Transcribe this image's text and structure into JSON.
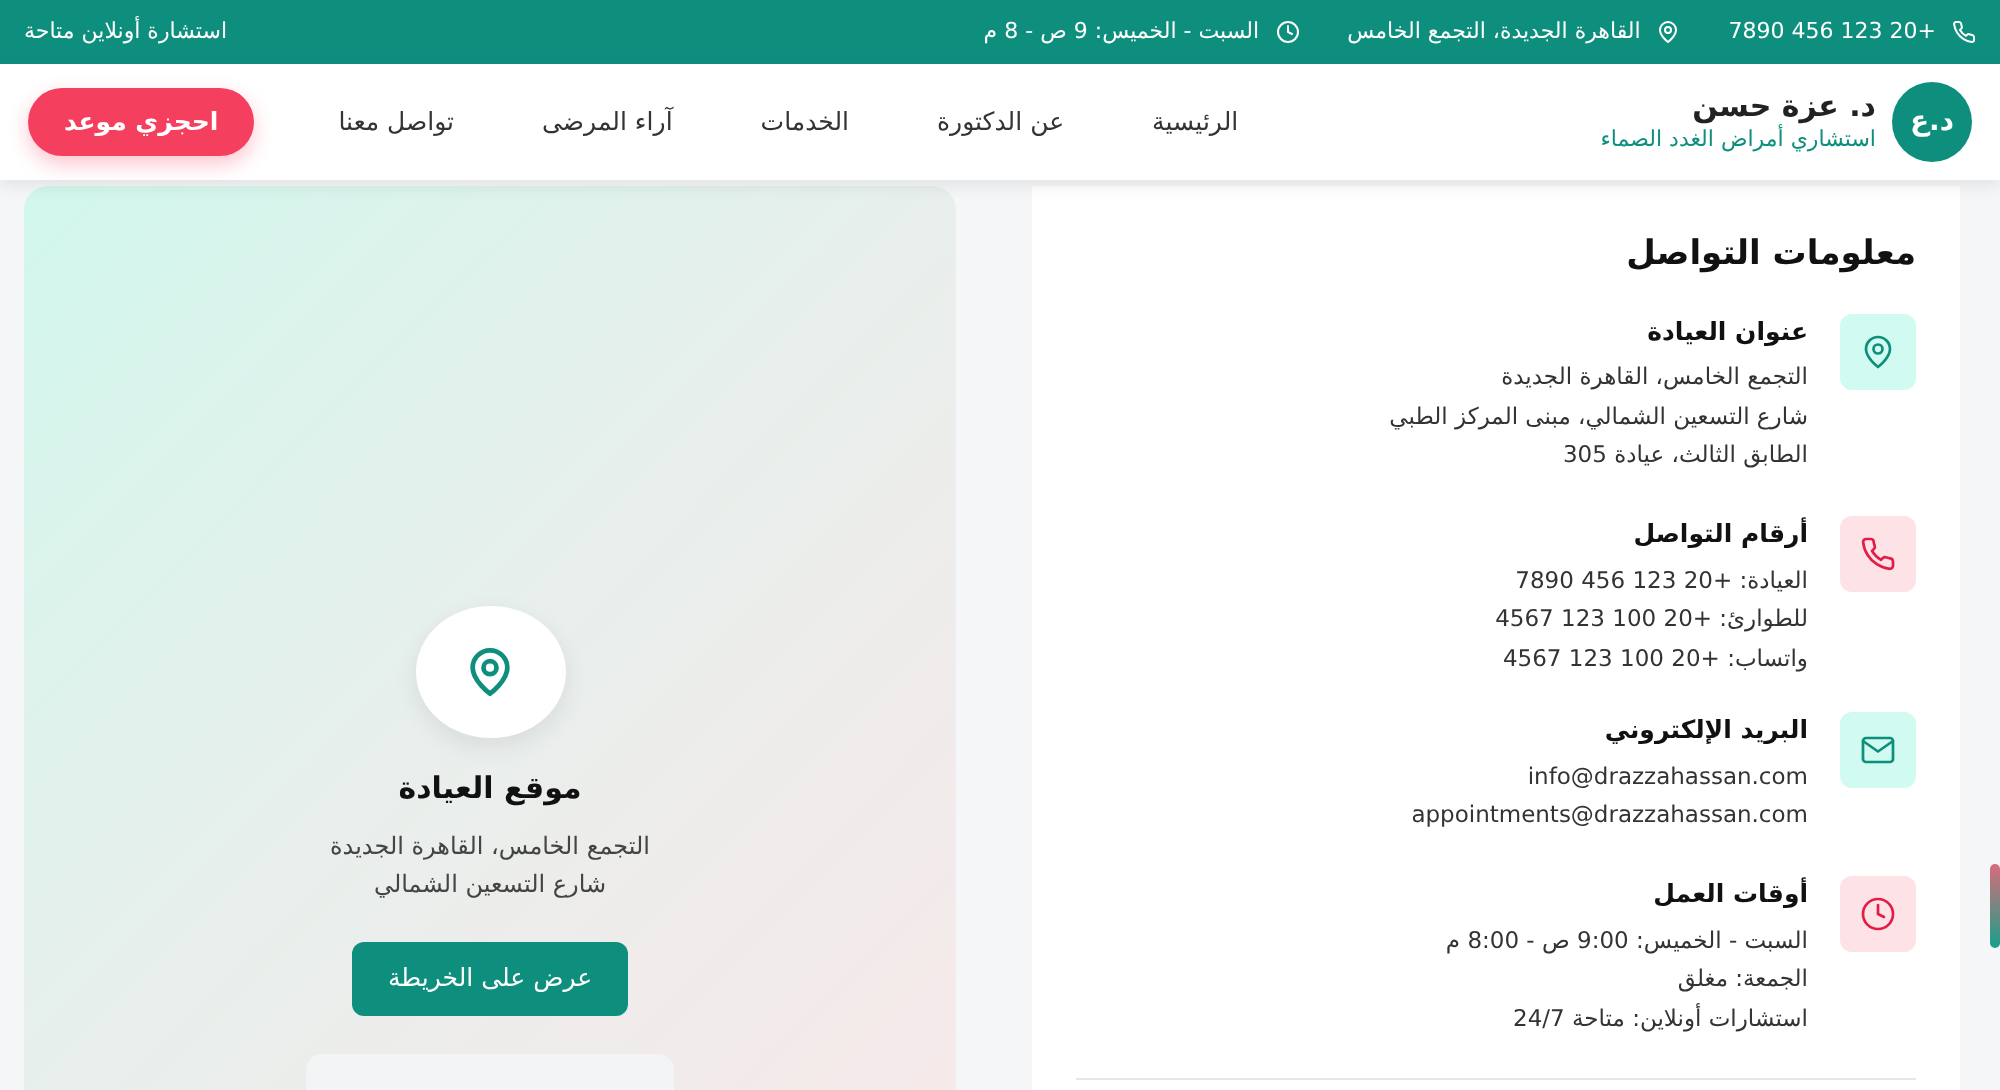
{
  "topbar": {
    "phone": "7890 456 123 20+",
    "address": "القاهرة الجديدة، التجمع الخامس",
    "hours": "السبت - الخميس: 9 ص - 8 م",
    "online": "استشارة أونلاين متاحة"
  },
  "brand": {
    "logo": "د.ع",
    "name": "د. عزة حسن",
    "subtitle": "استشاري أمراض الغدد الصماء"
  },
  "nav": [
    {
      "label": "الرئيسية"
    },
    {
      "label": "عن الدكتورة"
    },
    {
      "label": "الخدمات"
    },
    {
      "label": "آراء المرضى"
    },
    {
      "label": "تواصل معنا"
    }
  ],
  "cta": "احجزي موعد",
  "contact": {
    "title": "معلومات التواصل",
    "items": [
      {
        "kind": "location",
        "color": "#0e8f7e",
        "heading": "عنوان العيادة",
        "lines": [
          "التجمع الخامس، القاهرة الجديدة",
          "شارع التسعين الشمالي، مبنى المركز الطبي",
          "الطابق الثالث، عيادة 305"
        ]
      },
      {
        "kind": "phone",
        "color": "#e11d48",
        "heading": "أرقام التواصل",
        "lines": [
          "العيادة: +20 123 456 7890",
          "للطوارئ: +20 100 123 4567",
          "واتساب: +20 100 123 4567"
        ]
      },
      {
        "kind": "email",
        "color": "#0e8f7e",
        "heading": "البريد الإلكتروني",
        "lines": [
          "info@drazzahassan.com",
          "appointments@drazzahassan.com"
        ]
      },
      {
        "kind": "clock",
        "color": "#e11d48",
        "heading": "أوقات العمل",
        "lines": [
          "السبت - الخميس: 9:00 ص - 8:00 م",
          "الجمعة: مغلق",
          "استشارات أونلاين: متاحة 24/7"
        ]
      }
    ]
  },
  "map": {
    "title": "موقع العيادة",
    "lines": [
      "التجمع الخامس، القاهرة الجديدة",
      "شارع التسعين الشمالي"
    ],
    "button": "عرض على الخريطة"
  }
}
